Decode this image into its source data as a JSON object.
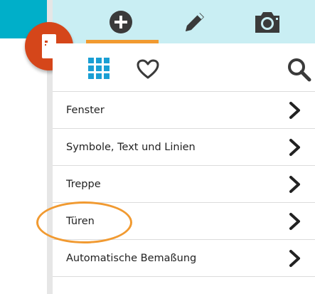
{
  "header": {
    "tabs": [
      {
        "icon": "plus-circle-icon",
        "active": true
      },
      {
        "icon": "pencil-icon",
        "active": false
      },
      {
        "icon": "camera-icon",
        "active": false
      }
    ],
    "fab_icon": "door-icon"
  },
  "toolbar": {
    "grid_icon": "grid-icon",
    "favorite_icon": "heart-icon",
    "search_icon": "search-icon"
  },
  "menu": {
    "items": [
      {
        "label": "Fenster"
      },
      {
        "label": "Symbole, Text und Linien"
      },
      {
        "label": "Treppe"
      },
      {
        "label": "Türen"
      },
      {
        "label": "Automatische Bemaßung"
      }
    ]
  },
  "colors": {
    "accent_orange": "#f19a31",
    "fab_red": "#d5461a",
    "header_teal": "#00afc9",
    "tabbar_light": "#c9eef3",
    "grid_blue": "#1a9fd4"
  }
}
